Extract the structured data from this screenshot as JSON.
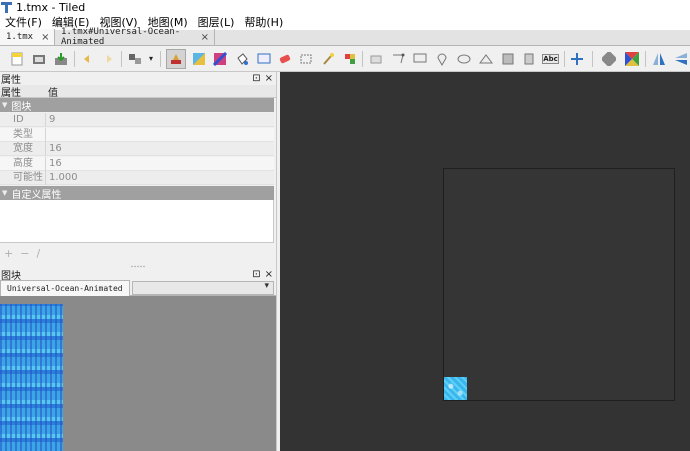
{
  "window": {
    "title": "1.tmx - Tiled"
  },
  "menu": [
    "文件(F)",
    "编辑(E)",
    "视图(V)",
    "地图(M)",
    "图层(L)",
    "帮助(H)"
  ],
  "doc_tabs": [
    {
      "label": "1.tmx",
      "close": "×"
    },
    {
      "label": "1.tmx#Universal-Ocean-Animated",
      "close": "×"
    }
  ],
  "properties": {
    "title": "属性",
    "col_property": "属性",
    "col_value": "值",
    "section_tile": "图块",
    "rows": [
      {
        "name": "ID",
        "value": "9"
      },
      {
        "name": "类型",
        "value": ""
      },
      {
        "name": "宽度",
        "value": "16"
      },
      {
        "name": "高度",
        "value": "16"
      },
      {
        "name": "可能性",
        "value": "1.000"
      }
    ],
    "section_custom": "自定义属性",
    "actions": {
      "add": "+",
      "remove": "−",
      "rename": "/"
    }
  },
  "tilesets": {
    "title": "图块",
    "tab": "Universal-Ocean-Animated"
  },
  "dock": {
    "float": "⊡",
    "close": "×"
  },
  "colors": {
    "canvas": "#333333",
    "section": "#a0a0a0",
    "accent": "#3b6fb6"
  }
}
